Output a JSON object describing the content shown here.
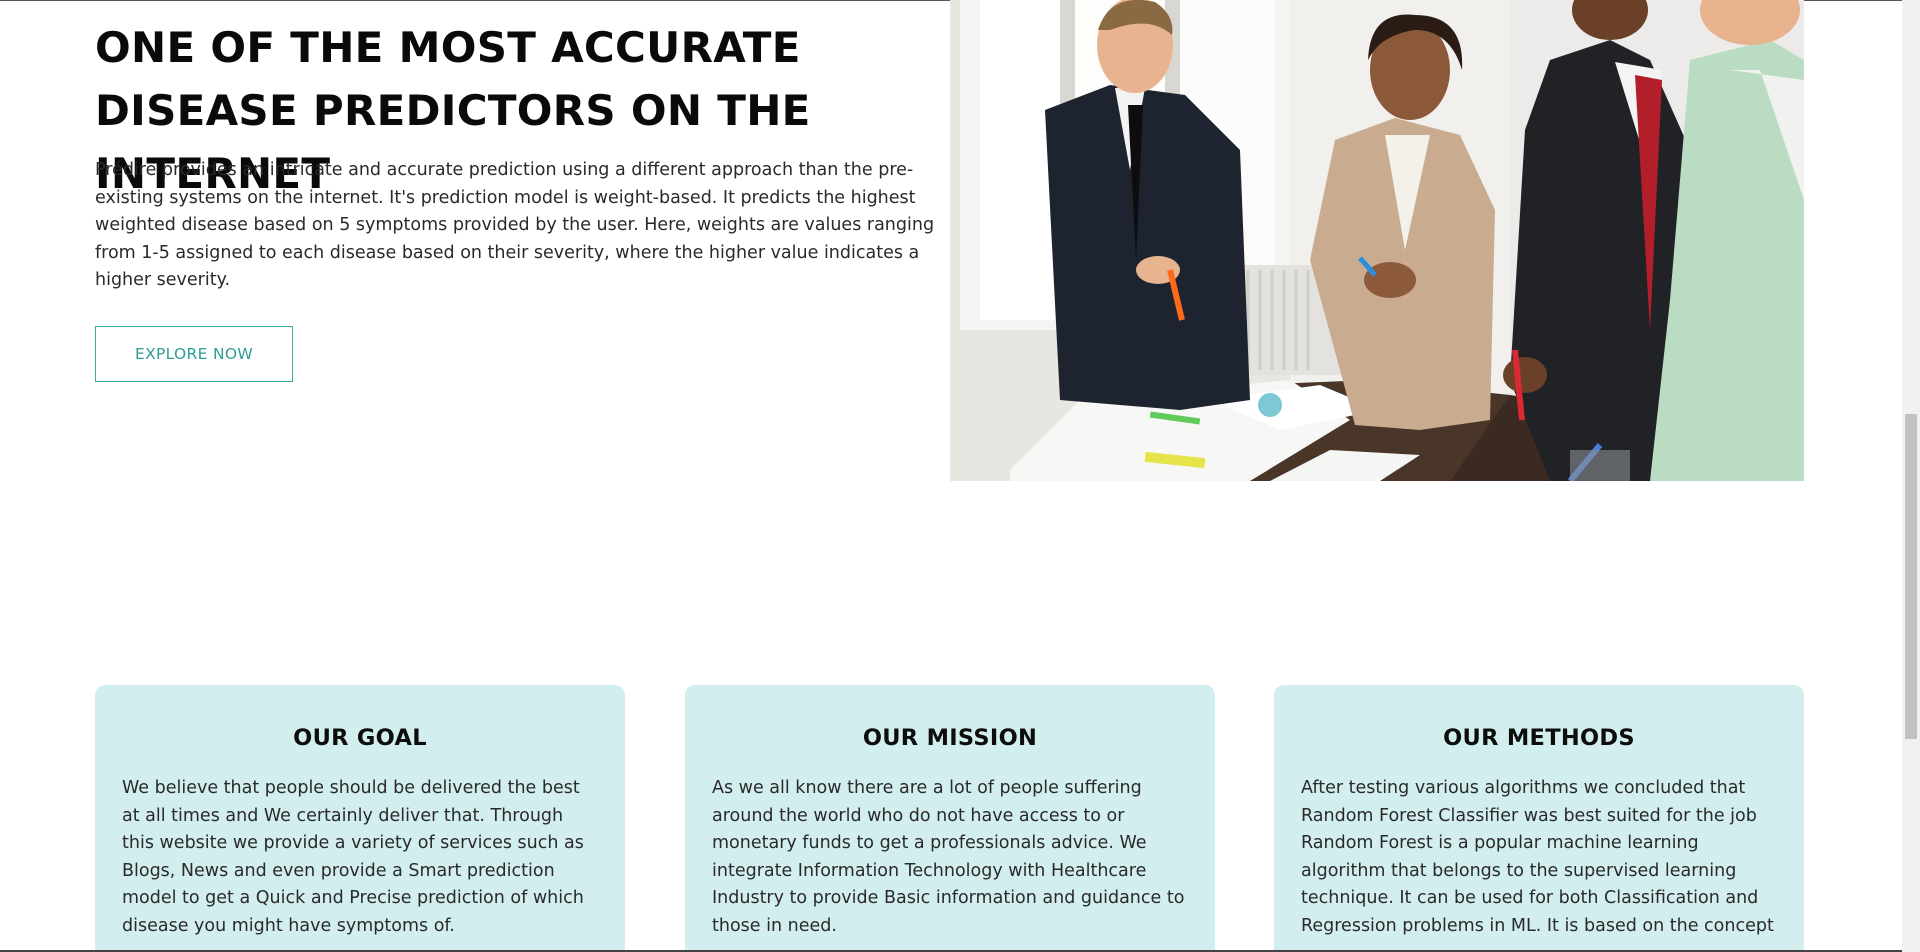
{
  "hero": {
    "title": "ONE OF THE MOST ACCURATE DISEASE PREDICTORS ON THE INTERNET",
    "description": "Prédire provides an intricate and accurate prediction using a different approach than the pre-existing systems on the internet. It's prediction model is weight-based. It predicts the highest weighted disease based on 5 symptoms provided by the user. Here, weights are values ranging from 1-5 assigned to each disease based on their severity, where the higher value indicates a higher severity.",
    "cta_label": "EXPLORE NOW"
  },
  "cards": [
    {
      "title": "OUR GOAL",
      "body": "We believe that people should be delivered the best at all times and We certainly deliver that. Through this website we provide a variety of services such as Blogs, News and even provide a Smart prediction model to get a Quick and Precise prediction of which disease you might have symptoms of."
    },
    {
      "title": "OUR MISSION",
      "body": "As we all know there are a lot of people suffering around the world who do not have access to or monetary funds to get a professionals advice. We integrate Information Technology with Healthcare Industry to provide Basic information and guidance to those in need."
    },
    {
      "title": "OUR METHODS",
      "body": "After testing various algorithms we concluded that Random Forest Classifier was best suited for the job Random Forest is a popular machine learning algorithm that belongs to the supervised learning technique. It can be used for both Classification and Regression problems in ML. It is based on the concept"
    }
  ],
  "colors": {
    "accent": "#3aaaa0",
    "card_bg": "#d3eeee"
  }
}
